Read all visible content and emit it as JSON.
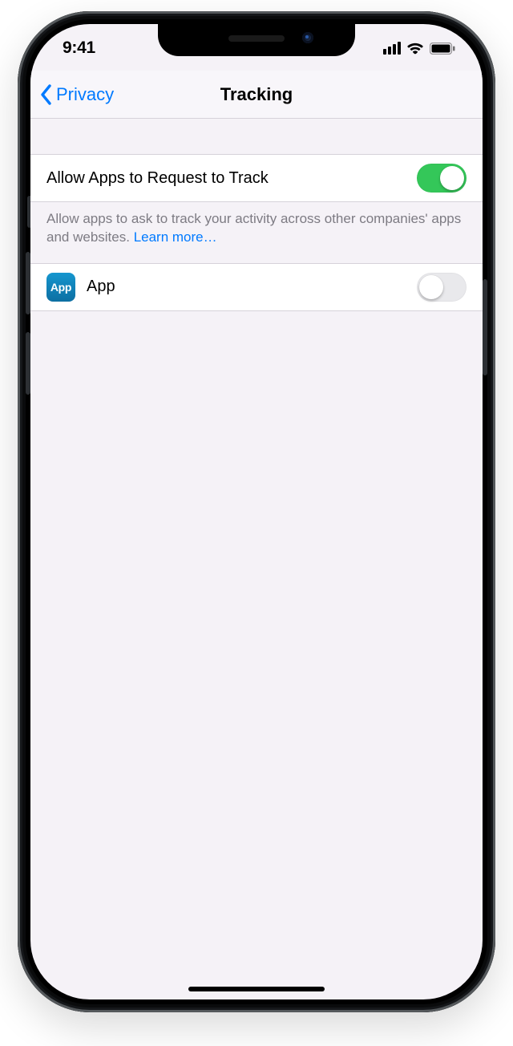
{
  "status": {
    "time": "9:41"
  },
  "nav": {
    "back": "Privacy",
    "title": "Tracking"
  },
  "row_allow": {
    "label": "Allow Apps to Request to Track",
    "enabled": true
  },
  "footer": {
    "text": "Allow apps to ask to track your activity across other companies' apps and websites. ",
    "link": "Learn more…"
  },
  "apps": [
    {
      "icon_label": "App",
      "name": "App",
      "enabled": false
    }
  ]
}
